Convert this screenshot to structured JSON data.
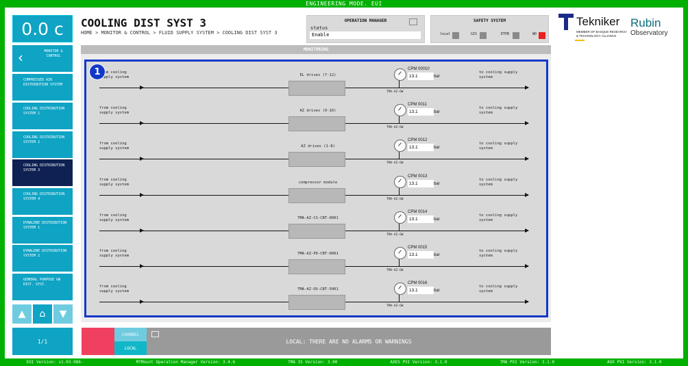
{
  "topbar": {
    "title": "ENGINEERING MODE. EUI"
  },
  "temperature": {
    "value": "0.0 c"
  },
  "nav": {
    "back_label": "MONITOR & CONTROL",
    "items": [
      {
        "label": "COMPRESSED AIR DISTRIBUTION SYSTEM",
        "active": false
      },
      {
        "label": "COOLING DISTRIBUTION SYSTEM 1",
        "active": false
      },
      {
        "label": "COOLING DISTRIBUTION SYSTEM 2",
        "active": false
      },
      {
        "label": "COOLING DISTRIBUTION SYSTEM 3",
        "active": true
      },
      {
        "label": "COOLING DISTRIBUTION SYSTEM 4",
        "active": false
      },
      {
        "label": "DYNALENE DISTRIBUTION SYSTEM 1",
        "active": false
      },
      {
        "label": "DYNALENE DISTRIBUTION SYSTEM 2",
        "active": false
      },
      {
        "label": "GENERAL PURPOSE GW DIST. SYST.",
        "active": false
      }
    ],
    "pager": "1/1"
  },
  "header": {
    "title": "COOLING DIST SYST 3",
    "breadcrumb": "HOME > MONITOR & CONTROL > FLUID SUPPLY SYSTEM > COOLING DIST SYST 3"
  },
  "operation_manager": {
    "title": "OPERATION MANAGER",
    "status_label": "status",
    "status_value": "Enable"
  },
  "safety_system": {
    "title": "SAFETY SYSTEM",
    "indicators": [
      {
        "label": "local",
        "color": "#8a8a8a"
      },
      {
        "label": "GIS",
        "color": "#8a8a8a"
      },
      {
        "label": "ETPB",
        "color": "#8a8a8a"
      },
      {
        "label": "WD",
        "color": "#e82020"
      }
    ]
  },
  "logos": {
    "tekniker": {
      "name": "Tekniker",
      "sub": "MEMBER OF BASQUE RESEARCH & TECHNOLOGY ALLIANCE"
    },
    "rubin": {
      "line1": "Rubin",
      "line2": "Observatory"
    }
  },
  "monitoring": {
    "title": "MONITORING",
    "badge": "1",
    "rows": [
      {
        "from": "from cooling supply system",
        "to": "to cooling supply system",
        "device": "EL drives (7-12)",
        "cpm": "CPM 00010",
        "value": "13.1",
        "unit": "bar",
        "tag": "TMA-AZ-GW"
      },
      {
        "from": "from cooling supply system",
        "to": "to cooling supply system",
        "device": "AZ drives (9-16)",
        "cpm": "CPM 0011",
        "value": "13.1",
        "unit": "bar",
        "tag": "TMA-AZ-GW"
      },
      {
        "from": "from cooling supply system",
        "to": "to cooling supply system",
        "device": "AZ drives (1-8)",
        "cpm": "CPM 0012",
        "value": "13.1",
        "unit": "bar",
        "tag": "TMA-AZ-GW"
      },
      {
        "from": "from cooling supply system",
        "to": "to cooling supply system",
        "device": "compressor module",
        "cpm": "CPM 0013",
        "value": "13.1",
        "unit": "bar",
        "tag": "TMA-AZ-GW"
      },
      {
        "from": "from cooling supply system",
        "to": "to cooling supply system",
        "device": "TMA-AZ-CS-CBT-0001",
        "cpm": "CPM 0014",
        "value": "13.1",
        "unit": "bar",
        "tag": "TMA-AZ-GW"
      },
      {
        "from": "from cooling supply system",
        "to": "to cooling supply system",
        "device": "TMA-AZ-PD-CBT-0001",
        "cpm": "CPM 0015",
        "value": "13.1",
        "unit": "bar",
        "tag": "TMA-AZ-GW"
      },
      {
        "from": "from cooling supply system",
        "to": "to cooling supply system",
        "device": "TMA-AZ-OS-CBT-5001",
        "cpm": "CPM 0016",
        "value": "13.1",
        "unit": "bar",
        "tag": "TMA-AZ-GW"
      }
    ]
  },
  "alarms": {
    "channel_label": "CHANNEL",
    "local_label": "LOCAL",
    "message": "LOCAL: THERE ARE NO ALARMS OR WARNINGS"
  },
  "footer": {
    "versions": [
      "EUI Version: v1.03-986-",
      "MTMount Operation Manager Version: 3.4.6",
      "TMA IS Version: 3.00",
      "AXES PXI Version: 3.1.0",
      "TMA PXI Version: 3.1.0",
      "AUX PXI Version: 3.1.0"
    ]
  }
}
